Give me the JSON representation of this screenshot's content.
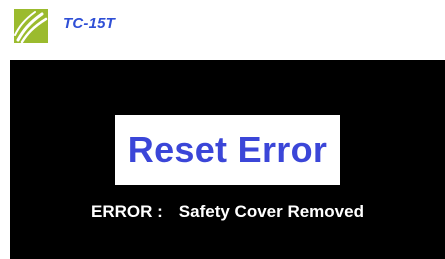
{
  "header": {
    "logo_icon": "leaf-swoosh-icon",
    "title": "TC-15T"
  },
  "screen": {
    "reset_label": "Reset Error",
    "error_label": "ERROR :",
    "error_message": "Safety Cover Removed"
  },
  "colors": {
    "logo_green": "#9bbb2e",
    "title_blue": "#2f4fd6",
    "button_text_blue": "#3b46d8",
    "screen_background": "#000000",
    "error_text": "#ffffff"
  }
}
